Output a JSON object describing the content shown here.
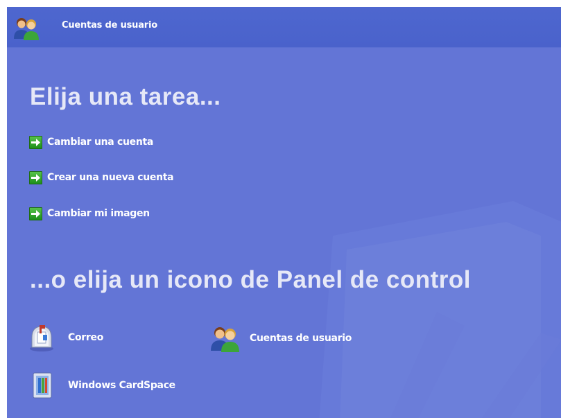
{
  "header": {
    "title": "Cuentas de usuario",
    "icon": "user-accounts-icon"
  },
  "tasks": {
    "heading": "Elija una tarea...",
    "items": [
      {
        "label": "Cambiar una cuenta",
        "icon": "green-arrow-icon"
      },
      {
        "label": "Crear una nueva cuenta",
        "icon": "green-arrow-icon"
      },
      {
        "label": "Cambiar mi imagen",
        "icon": "green-arrow-icon"
      }
    ]
  },
  "control_panel": {
    "heading": "...o elija un icono de Panel de control",
    "items": [
      {
        "label": "Correo",
        "icon": "mail-icon"
      },
      {
        "label": "Cuentas de usuario",
        "icon": "user-accounts-icon"
      },
      {
        "label": "Windows CardSpace",
        "icon": "cardspace-icon"
      }
    ]
  },
  "colors": {
    "background": "#6375d6",
    "header": "#4a62cb",
    "arrow": "#2aa423"
  }
}
